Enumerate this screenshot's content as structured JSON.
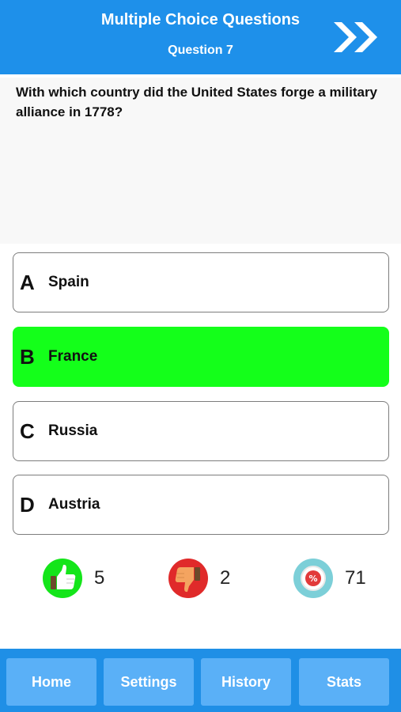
{
  "header": {
    "title": "Multiple Choice Questions",
    "subtitle": "Question 7",
    "next_icon": "double-chevron-right-icon",
    "background_color": "#1e90ea"
  },
  "question": {
    "text": "With which country did the United States forge a military alliance in 1778?"
  },
  "answers": [
    {
      "letter": "A",
      "text": "Spain",
      "state": "default"
    },
    {
      "letter": "B",
      "text": "France",
      "state": "correct"
    },
    {
      "letter": "C",
      "text": "Russia",
      "state": "default"
    },
    {
      "letter": "D",
      "text": "Austria",
      "state": "default"
    }
  ],
  "colors": {
    "correct_answer": "#14ff1a",
    "accent": "#1e90ea"
  },
  "stats": {
    "correct": {
      "icon": "thumbs-up-icon",
      "count": "5"
    },
    "wrong": {
      "icon": "thumbs-down-icon",
      "count": "2"
    },
    "percent": {
      "icon": "percent-badge-icon",
      "count": "71"
    }
  },
  "tabs": [
    {
      "label": "Home"
    },
    {
      "label": "Settings"
    },
    {
      "label": "History"
    },
    {
      "label": "Stats"
    }
  ]
}
